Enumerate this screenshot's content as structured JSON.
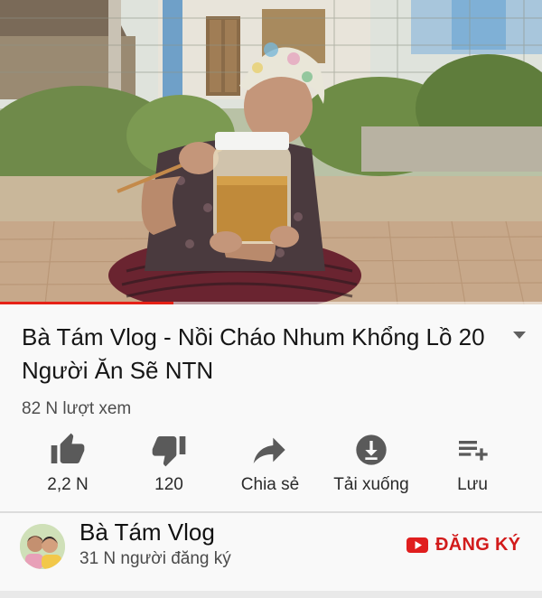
{
  "video": {
    "progress_fraction": 0.32,
    "progress_color": "#e62117"
  },
  "title": {
    "text": "Bà Tám Vlog -  Nồi Cháo Nhum Khổng Lồ 20 Người Ăn Sẽ NTN",
    "expand_icon": "chevron-down-icon"
  },
  "views_text": "82 N lượt xem",
  "actions": [
    {
      "icon": "thumbs-up-icon",
      "label": "2,2 N"
    },
    {
      "icon": "thumbs-down-icon",
      "label": "120"
    },
    {
      "icon": "share-icon",
      "label": "Chia sẻ"
    },
    {
      "icon": "download-icon",
      "label": "Tải xuống"
    },
    {
      "icon": "playlist-add-icon",
      "label": "Lưu"
    }
  ],
  "channel": {
    "name": "Bà Tám Vlog",
    "subscribers": "31 N người đăng ký",
    "subscribe_label": "ĐĂNG KÝ",
    "subscribe_color": "#d21b1b"
  }
}
